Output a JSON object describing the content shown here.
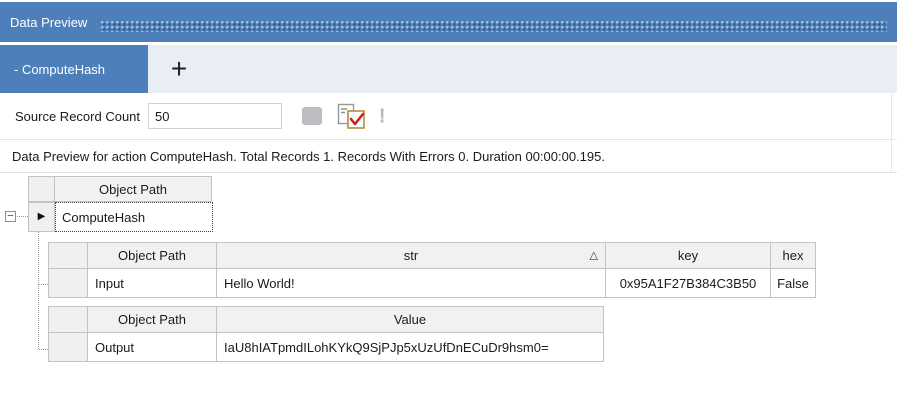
{
  "panel": {
    "title": "Data Preview"
  },
  "tabs": {
    "active_label": "- ComputeHash",
    "add_label": "+"
  },
  "toolbar": {
    "source_record_count_label": "Source Record Count",
    "source_record_count_value": "50"
  },
  "summary": {
    "text": "Data Preview for action ComputeHash. Total Records 1. Records With Errors 0. Duration 00:00:00.195."
  },
  "grid": {
    "root": {
      "header": "Object Path",
      "row_value": "ComputeHash"
    },
    "input_table": {
      "headers": [
        "Object Path",
        "str",
        "key",
        "hex"
      ],
      "row": {
        "object_path": "Input",
        "str": "Hello World!",
        "key": "0x95A1F27B384C3B50",
        "hex": "False"
      }
    },
    "output_table": {
      "headers": [
        "Object Path",
        "Value"
      ],
      "row": {
        "object_path": "Output",
        "value": "IaU8hIATpmdILohKYkQ9SjPJp5xUzUfDnECuDr9hsm0="
      }
    }
  },
  "icons": {
    "sort_glyph": "△",
    "expand_glyph": "−",
    "row_selector_glyph": "▶",
    "warning_glyph": "!"
  },
  "colors": {
    "accent_blue": "#4d7fba",
    "tab_strip": "#e9eef4",
    "header_gray": "#f1f1f1",
    "grid_border": "#c3c3c3",
    "check_red": "#c5271c"
  }
}
